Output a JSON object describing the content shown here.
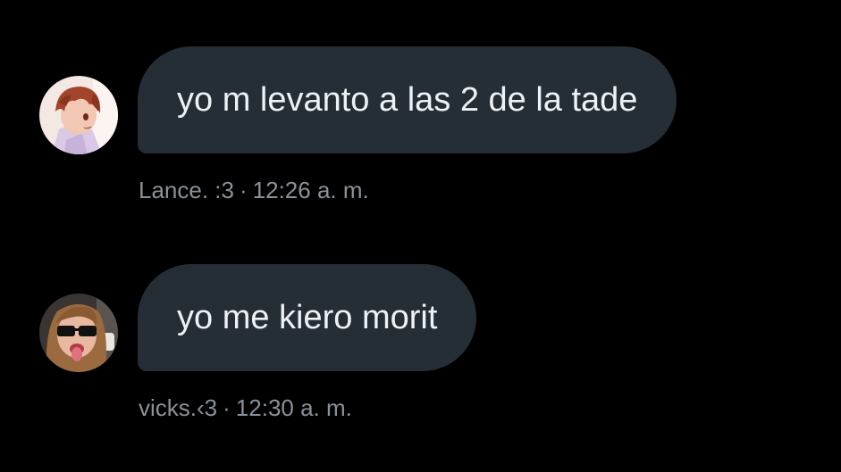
{
  "messages": [
    {
      "text": "yo m levanto a las 2 de la tade",
      "sender": "Lance. :3",
      "separator": "·",
      "time": "12:26 a. m.",
      "avatar_icon": "anime-boy-avatar-icon"
    },
    {
      "text": "yo me kiero morit",
      "sender": "vicks.‹3",
      "separator": "·",
      "time": "12:30 a. m.",
      "avatar_icon": "sunglasses-selfie-avatar-icon"
    }
  ],
  "colors": {
    "background": "#000000",
    "bubble": "#252d35",
    "message_text": "#eef2f5",
    "meta_text": "#8a9299"
  }
}
